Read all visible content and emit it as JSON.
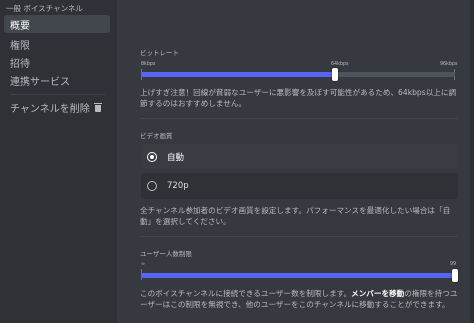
{
  "sidebar": {
    "header": "一般 ボイスチャンネル",
    "items": [
      {
        "label": "概要",
        "active": true
      },
      {
        "label": "権限",
        "active": false
      },
      {
        "label": "招待",
        "active": false
      },
      {
        "label": "連携サービス",
        "active": false
      }
    ],
    "delete_label": "チャンネルを削除"
  },
  "bitrate": {
    "title": "ビットレート",
    "min_label": "8kbps",
    "mid_label": "64kbps",
    "max_label": "96kbps",
    "value_kbps": 64,
    "min_kbps": 8,
    "max_kbps": 96,
    "warning": "上げすぎ注意！回線が貧弱なユーザーに悪影響を及ぼす可能性があるため、64kbps以上に調節するのはおすすめしません。"
  },
  "video_quality": {
    "title": "ビデオ画質",
    "options": [
      {
        "label": "自動",
        "selected": true
      },
      {
        "label": "720p",
        "selected": false
      }
    ],
    "description": "全チャンネル参加者のビデオ画質を設定します。パフォーマンスを最適化したい場合は「自動」を選択してください。"
  },
  "user_limit": {
    "title": "ユーザー人数制限",
    "min_label": "∞",
    "max_label": "99",
    "value": 99,
    "description_pre": "このボイスチャンネルに接続できるユーザー数を制限します。",
    "description_bold": "メンバーを移動",
    "description_post": "の権限を持つユーザーはこの制限を無視でき、他のユーザーをこのチャンネルに移動することができます。"
  },
  "colors": {
    "accent": "#5865f2",
    "background": "#36393f",
    "sidebar": "#2f3136"
  }
}
